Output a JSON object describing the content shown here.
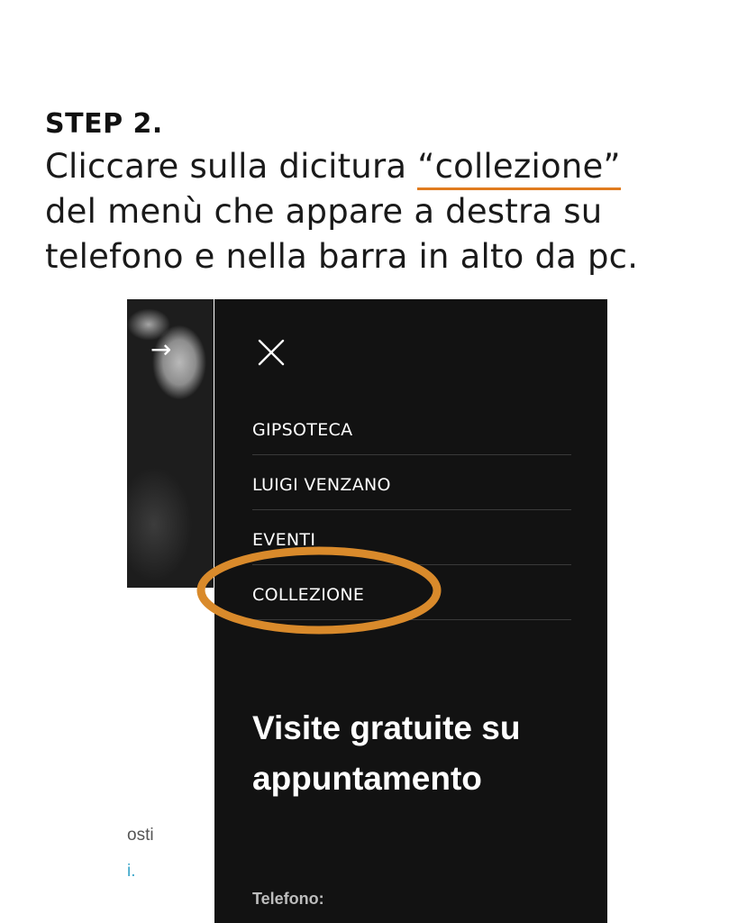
{
  "tutorial": {
    "step_label": "STEP 2.",
    "instruction_prefix": "Cliccare sulla dicitura ",
    "instruction_highlight": "“collezione”",
    "instruction_line2": "del menù che appare a destra su",
    "instruction_line3": "telefono e nella barra in alto da pc.",
    "highlight_color": "#e07b1f"
  },
  "screenshot": {
    "arrow_icon": "→",
    "page_snippet_1": "osti",
    "page_snippet_2": "i.",
    "menu": {
      "close_icon": "close-icon",
      "items": [
        {
          "label": "GIPSOTECA"
        },
        {
          "label": "LUIGI VENZANO"
        },
        {
          "label": "EVENTI"
        },
        {
          "label": "COLLEZIONE"
        }
      ],
      "heading_line1": "Visite gratuite su",
      "heading_line2": "appuntamento",
      "phone_label": "Telefono:",
      "background_color": "#121212"
    }
  }
}
